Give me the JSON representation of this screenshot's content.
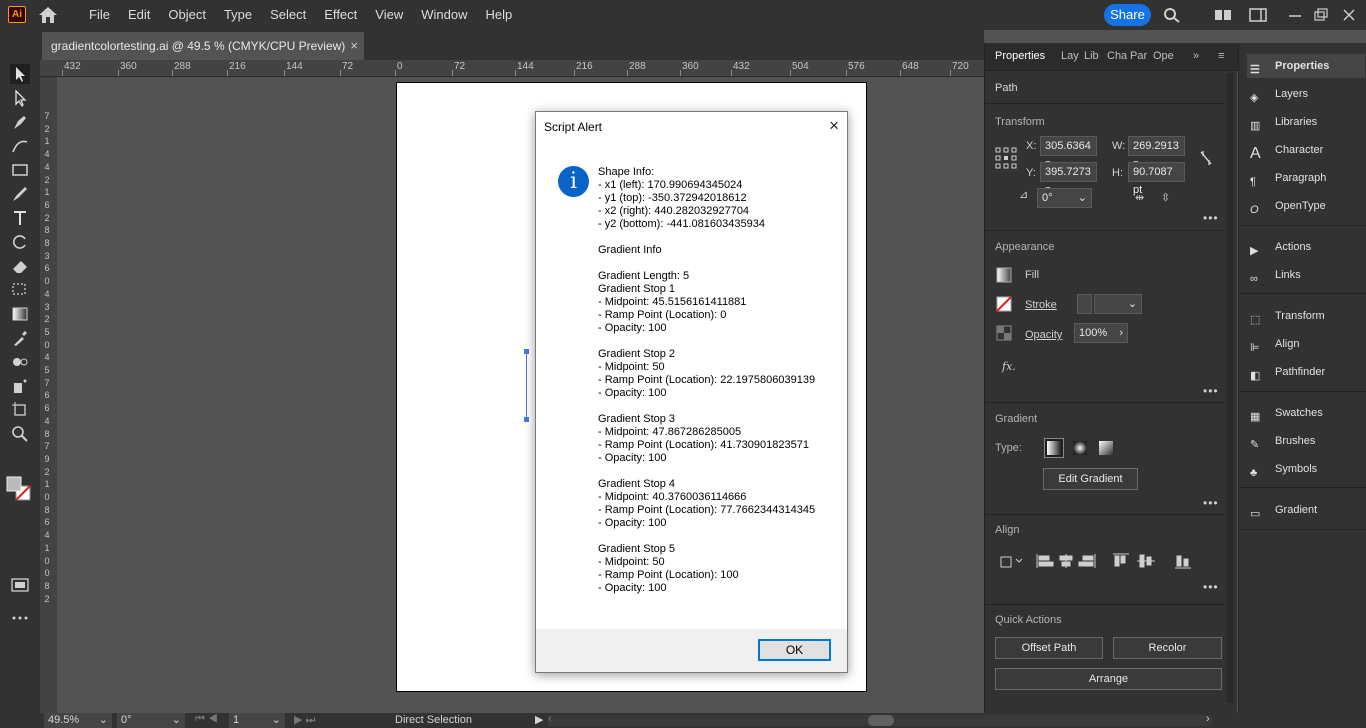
{
  "app": {
    "logo_text": "Ai"
  },
  "menu": [
    "File",
    "Edit",
    "Object",
    "Type",
    "Select",
    "Effect",
    "View",
    "Window",
    "Help"
  ],
  "topbar": {
    "share_label": "Share"
  },
  "document_tab": {
    "title": "gradientcolortesting.ai @ 49.5 % (CMYK/CPU Preview)",
    "close": "×"
  },
  "ruler_top": [
    "432",
    "360",
    "288",
    "216",
    "144",
    "72",
    "0",
    "72",
    "144",
    "216",
    "288",
    "360",
    "432",
    "504",
    "576",
    "648",
    "720"
  ],
  "ruler_left": [
    "7",
    "2",
    "1",
    "4",
    "4",
    "2",
    "1",
    "6",
    "2",
    "8",
    "8",
    "3",
    "6",
    "0",
    "4",
    "3",
    "2",
    "5",
    "0",
    "4",
    "5",
    "7",
    "6",
    "6",
    "4",
    "8",
    "7",
    "9",
    "2",
    "1",
    "0",
    "8",
    "6",
    "4",
    "1",
    "0",
    "0",
    "8",
    "2"
  ],
  "dialog": {
    "title": "Script Alert",
    "close": "×",
    "info_glyph": "i",
    "lines": [
      "Shape Info:",
      "- x1 (left): 170.990694345024",
      "- y1 (top): -350.372942018612",
      "- x2 (right): 440.282032927704",
      "- y2 (bottom): -441.081603435934",
      "",
      "Gradient Info",
      "",
      "Gradient Length: 5",
      "Gradient Stop 1",
      "- Midpoint: 45.5156161411881",
      "- Ramp Point (Location): 0",
      "- Opacity: 100",
      "",
      "Gradient Stop 2",
      "- Midpoint: 50",
      "- Ramp Point (Location): 22.1975806039139",
      "- Opacity: 100",
      "",
      "Gradient Stop 3",
      "- Midpoint: 47.867286285005",
      "- Ramp Point (Location): 41.730901823571",
      "- Opacity: 100",
      "",
      "Gradient Stop 4",
      "- Midpoint: 40.3760036114666",
      "- Ramp Point (Location): 77.7662344314345",
      "- Opacity: 100",
      "",
      "Gradient Stop 5",
      "- Midpoint: 50",
      "- Ramp Point (Location): 100",
      "- Opacity: 100"
    ],
    "ok_label": "OK"
  },
  "properties": {
    "tabs": [
      "Properties",
      "Lay",
      "Lib",
      "Cha",
      "Par",
      "Ope"
    ],
    "path_label": "Path",
    "transform": {
      "label": "Transform",
      "x_label": "X:",
      "x": "305.6364 p",
      "y_label": "Y:",
      "y": "395.7273 p",
      "w_label": "W:",
      "w": "269.2913 p",
      "h_label": "H:",
      "h": "90.7087 pt",
      "angle": "0°"
    },
    "appearance": {
      "label": "Appearance",
      "fill": "Fill",
      "stroke": "Stroke",
      "opacity_label": "Opacity",
      "opacity": "100%",
      "fx": "fx."
    },
    "gradient": {
      "label": "Gradient",
      "type_label": "Type:",
      "edit_button": "Edit Gradient"
    },
    "align": {
      "label": "Align"
    },
    "quick_actions": {
      "label": "Quick Actions",
      "offset_path": "Offset Path",
      "recolor": "Recolor",
      "arrange": "Arrange"
    },
    "more": "•••"
  },
  "right_panel": {
    "group1": [
      "Properties",
      "Layers",
      "Libraries",
      "Character",
      "Paragraph",
      "OpenType"
    ],
    "group2": [
      "Actions",
      "Links"
    ],
    "group3": [
      "Transform",
      "Align",
      "Pathfinder"
    ],
    "group4": [
      "Swatches",
      "Brushes",
      "Symbols"
    ],
    "group5": [
      "Gradient"
    ]
  },
  "statusbar": {
    "zoom": "49.5%",
    "rotate": "0°",
    "artboard": "1",
    "tool": "Direct Selection"
  },
  "colors": {
    "accent": "#1473e6",
    "panel": "#323232",
    "canvas": "#535353",
    "info": "#0a64c8"
  }
}
